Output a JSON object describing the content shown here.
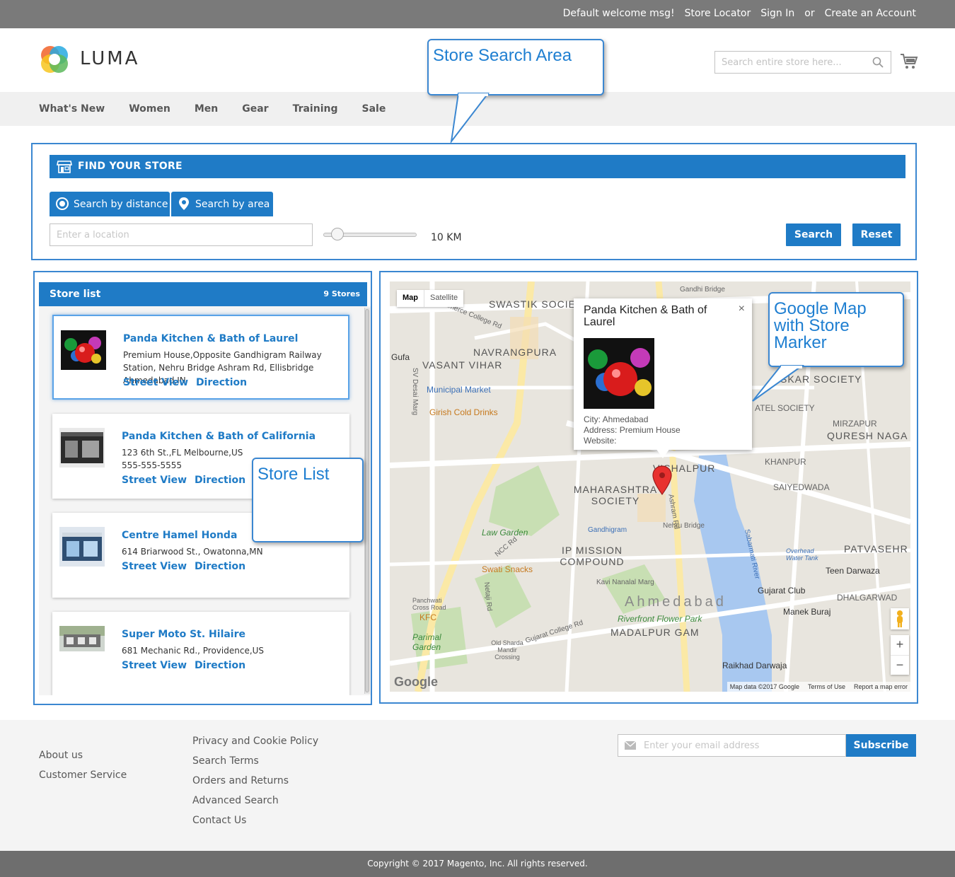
{
  "topbar": {
    "welcome": "Default welcome msg!",
    "store_locator": "Store Locator",
    "sign_in": "Sign In",
    "or": "or",
    "create_account": "Create an Account"
  },
  "header": {
    "logo_text": "LUMA",
    "search_placeholder": "Search entire store here...",
    "icons": [
      "search-icon",
      "cart-icon"
    ]
  },
  "nav": {
    "items": [
      "What's New",
      "Women",
      "Men",
      "Gear",
      "Training",
      "Sale"
    ]
  },
  "callouts": {
    "search_area": "Store Search Area",
    "store_list": "Store List",
    "google_map": "Google Map with Store Marker"
  },
  "find_store": {
    "title": "FIND YOUR STORE",
    "tab_distance": "Search by distance",
    "tab_area": "Search by area",
    "location_placeholder": "Enter a location",
    "radius_label": "10 KM",
    "radius_slider_fraction": 0.15,
    "search_label": "Search",
    "reset_label": "Reset"
  },
  "store_list": {
    "title": "Store list",
    "count": "9 Stores",
    "stores": [
      {
        "name": "Panda Kitchen & Bath of Laurel",
        "address": "Premium House,Opposite Gandhigram Railway Station, Nehru Bridge Ashram Rd, Ellisbridge Ahmedabad,IN",
        "street_view": "Street View",
        "direction": "Direction"
      },
      {
        "name": "Panda Kitchen & Bath of California",
        "address": "123 6th St.,FL Melbourne,US",
        "phone": "555-555-5555",
        "street_view": "Street View",
        "direction": "Direction"
      },
      {
        "name": "Centre Hamel Honda",
        "address": "614 Briarwood St., Owatonna,MN",
        "street_view": "Street View",
        "direction": "Direction"
      },
      {
        "name": "Super Moto St. Hilaire",
        "address": "681 Mechanic Rd., Providence,US",
        "street_view": "Street View",
        "direction": "Direction"
      }
    ]
  },
  "map": {
    "toggle_map": "Map",
    "toggle_satellite": "Satellite",
    "info_title": "Panda Kitchen & Bath of Laurel",
    "info_close": "×",
    "info_city": "City: Ahmedabad",
    "info_address": "Address: Premium House",
    "info_website": "Website:",
    "zoom_in": "+",
    "zoom_out": "−",
    "google_logo": "Google",
    "attribution": [
      "Map data ©2017 Google",
      "Terms of Use",
      "Report a map error"
    ],
    "labels": {
      "swastik": "SWASTIK SOCIETY",
      "navrangpura": "NAVRANGPURA",
      "vasant_vihar": "VASANT VIHAR",
      "gufa": "Gufa",
      "municipal_market": "Municipal Market",
      "girish": "Girish Cold Drinks",
      "commerce": "Commerce College Rd",
      "gandhi_bridge": "Gandhi Bridge",
      "sanskar": "SKAR SOCIETY",
      "atel": "ATEL SOCIETY",
      "mirzapur": "MIRZAPUR",
      "qureshnaga": "QURESH NAGA",
      "khanpur": "KHANPUR",
      "vishalpur": "VISHALPUR",
      "saiyedwada": "SAIYEDWADA",
      "maharashtra": "MAHARASHTRA SOCIETY",
      "law_garden": "Law Garden",
      "gandhigram": "Gandhigram",
      "nehru_bridge": "Nehru Bridge",
      "ip_mission": "IP MISSION COMPOUND",
      "swati": "Swati Snacks",
      "patvasehr": "PATVASEHR",
      "teen_darwaza": "Teen Darwaza",
      "kavi": "Kavi Nanalal Marg",
      "ahmedabad": "Ahmedabad",
      "gujarat_club": "Gujarat Club",
      "dhalgarwad": "DHALGARWAD",
      "manek_buraj": "Manek Buraj",
      "riverfront": "Riverfront Flower Park",
      "madalpur": "MADALPUR GAM",
      "kfc": "KFC",
      "parimal": "Parimal Garden",
      "raikhad": "Raikhad Darwaja",
      "sabarmati": "Sabarmati River",
      "panchwati": "Panchwati Cross Road",
      "old_sharda": "Old Sharda Mandir Crossing",
      "sv_desai": "SV Desai Marg",
      "ashram_rd": "Ashram Rd",
      "netaji": "Netaji Rd",
      "ncc": "NCC Rd",
      "gujarat_college": "Gujarat College Rd",
      "overhead": "Overhead Water Tank"
    }
  },
  "footer": {
    "col1": [
      "About us",
      "Customer Service"
    ],
    "col2": [
      "Privacy and Cookie Policy",
      "Search Terms",
      "Orders and Returns",
      "Advanced Search",
      "Contact Us"
    ],
    "email_placeholder": "Enter your email address",
    "subscribe_label": "Subscribe",
    "copyright": "Copyright © 2017 Magento, Inc. All rights reserved."
  }
}
